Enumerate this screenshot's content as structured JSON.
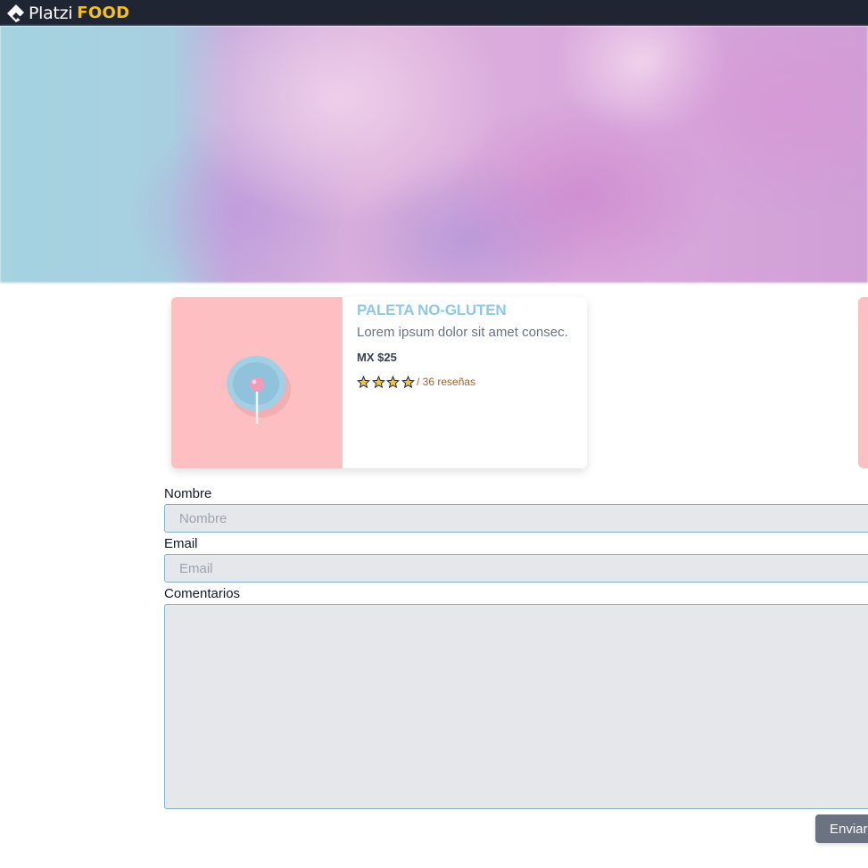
{
  "navbar": {
    "brand_primary": "Platzi",
    "brand_secondary": "FOOD",
    "logo_icon": "platzi-logo-icon"
  },
  "hero": {
    "image": "blurred pastel candy background",
    "colors": [
      "#a5d3e0",
      "#d9a8dc",
      "#c7aadc"
    ]
  },
  "product_card": {
    "image": "pink lollipop on blue plate",
    "title": "PALETA NO-GLUTEN",
    "description": "Lorem ipsum dolor sit amet consec.",
    "price": "MX $25",
    "rating": 4,
    "reviews": "/ 36 reseñas",
    "title_color": "#8ec8e8",
    "image_bg_color": "#fdbfc1"
  },
  "form": {
    "name_label": "Nombre",
    "name_placeholder": "Nombre",
    "email_label": "Email",
    "email_placeholder": "Email",
    "comments_label": "Comentarios",
    "comments_value": "",
    "submit_label": "Enviar"
  },
  "colors": {
    "navbar_bg": "#1f2533",
    "brand_accent": "#f4c11b",
    "input_bg": "#e5e7eb",
    "input_border": "#7fb3d5",
    "button_bg": "#6b7280"
  }
}
